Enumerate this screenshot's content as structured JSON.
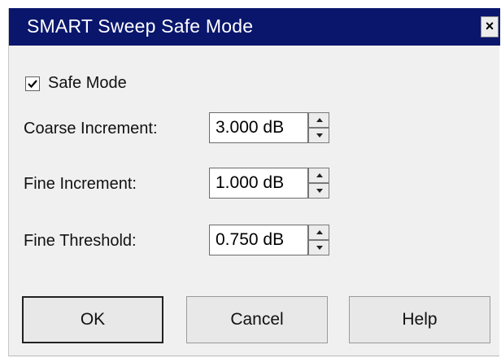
{
  "window": {
    "title": "SMART Sweep Safe Mode",
    "close_label": "×"
  },
  "safe_mode": {
    "label": "Safe Mode",
    "checked": true
  },
  "fields": [
    {
      "label": "Coarse Increment:",
      "value": "3.000 dB"
    },
    {
      "label": "Fine Increment:",
      "value": "1.000 dB"
    },
    {
      "label": "Fine Threshold:",
      "value": "0.750 dB"
    }
  ],
  "buttons": {
    "ok": "OK",
    "cancel": "Cancel",
    "help": "Help"
  },
  "colors": {
    "titlebar": "#09166c",
    "dialog_bg": "#f0f0f0"
  }
}
